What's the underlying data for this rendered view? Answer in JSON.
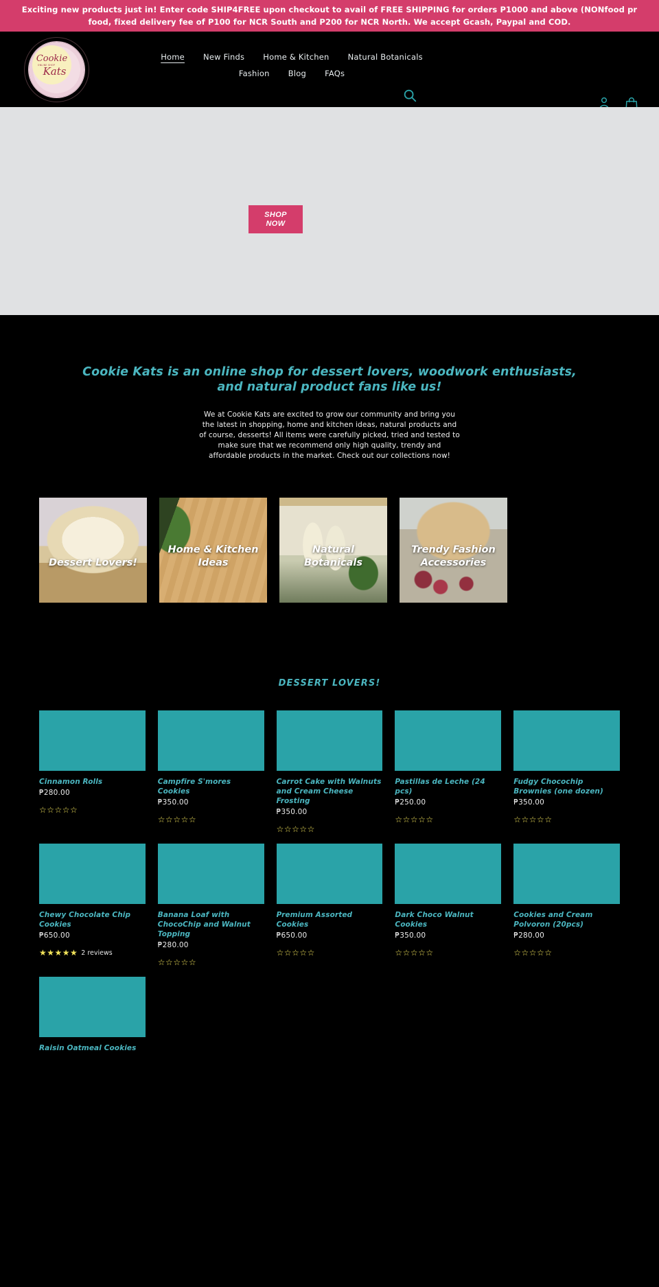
{
  "announcement": {
    "line1": "Exciting new products just in! Enter code SHIP4FREE upon checkout to avail of FREE SHIPPING for orders P1000 and above (NONfood pr",
    "line2": "food, fixed delivery fee of P100 for NCR South and P200 for NCR North. We accept Gcash, Paypal and COD.",
    "bg_color": "#d43d6b"
  },
  "header": {
    "logo": {
      "line_top": "Cookie",
      "line_small": "ONLINE SHOP",
      "line_bottom": "Kats"
    },
    "nav_row1": [
      {
        "label": "Home",
        "active": true
      },
      {
        "label": "New Finds",
        "active": false
      },
      {
        "label": "Home & Kitchen",
        "active": false
      },
      {
        "label": "Natural Botanicals",
        "active": false
      }
    ],
    "nav_row2": [
      {
        "label": "Fashion",
        "active": false
      },
      {
        "label": "Blog",
        "active": false
      },
      {
        "label": "FAQs",
        "active": false
      }
    ],
    "icons": {
      "search": "search-icon",
      "account": "account-icon",
      "cart": "shopping-bag-icon"
    },
    "accent_color": "#2aa3a8"
  },
  "hero": {
    "shop_now_line1": "SHOP",
    "shop_now_line2": "NOW",
    "button_color": "#d43d6b",
    "bg_color": "#e0e1e3"
  },
  "intro": {
    "heading": "Cookie Kats is an online shop for dessert lovers, woodwork enthusiasts, and natural product fans like us!",
    "body": "We at Cookie Kats are excited to grow our community and bring you the latest in shopping, home and kitchen ideas, natural products and of course, desserts! All items were carefully picked, tried and tested to make sure that we recommend only high quality, trendy and affordable products in the market. Check out our collections now!",
    "heading_color": "#4bb6c0"
  },
  "categories": [
    {
      "label": "Dessert Lovers!",
      "image": "layer-cake-photo"
    },
    {
      "label": "Home & Kitchen Ideas",
      "image": "wood-cutting-board-photo"
    },
    {
      "label": "Natural Botanicals",
      "image": "essential-oil-bottles-photo"
    },
    {
      "label": "Trendy Fashion Accessories",
      "image": "woven-basket-bag-photo"
    }
  ],
  "collection": {
    "title": "DESSERT LOVERS!",
    "products": [
      {
        "name": "Cinnamon Rolls",
        "price": "₱280.00",
        "stars": 0,
        "reviews": ""
      },
      {
        "name": "Campfire S'mores Cookies",
        "price": "₱350.00",
        "stars": 0,
        "reviews": ""
      },
      {
        "name": "Carrot Cake with Walnuts and Cream Cheese Frosting",
        "price": "₱350.00",
        "stars": 0,
        "reviews": ""
      },
      {
        "name": "Pastillas de Leche (24 pcs)",
        "price": "₱250.00",
        "stars": 0,
        "reviews": ""
      },
      {
        "name": "Fudgy Chocochip Brownies (one dozen)",
        "price": "₱350.00",
        "stars": 0,
        "reviews": ""
      },
      {
        "name": "Chewy Chocolate Chip Cookies",
        "price": "₱650.00",
        "stars": 5,
        "reviews": "2 reviews"
      },
      {
        "name": "Banana Loaf with ChocoChip and Walnut Topping",
        "price": "₱280.00",
        "stars": 0,
        "reviews": ""
      },
      {
        "name": "Premium Assorted Cookies",
        "price": "₱650.00",
        "stars": 0,
        "reviews": ""
      },
      {
        "name": "Dark Choco Walnut Cookies",
        "price": "₱350.00",
        "stars": 0,
        "reviews": ""
      },
      {
        "name": "Cookies and Cream Polvoron (20pcs)",
        "price": "₱280.00",
        "stars": 0,
        "reviews": ""
      },
      {
        "name": "Raisin Oatmeal Cookies",
        "price": "",
        "stars": 0,
        "reviews": ""
      }
    ]
  }
}
